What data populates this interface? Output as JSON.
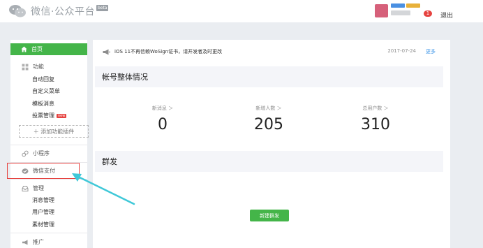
{
  "header": {
    "logo_text": "微信·公众平台",
    "beta_label": "beta",
    "notification_count": "1",
    "logout_label": "退出"
  },
  "sidebar": {
    "home_label": "首页",
    "function_group": "功能",
    "function_items": [
      "自动回复",
      "自定义菜单",
      "模板消息",
      "投票管理"
    ],
    "new_badge": "new",
    "add_plugin_label": "＋ 添加功能插件",
    "mini_program_label": "小程序",
    "wechat_pay_label": "微信支付",
    "management_group": "管理",
    "management_items": [
      "消息管理",
      "用户管理",
      "素材管理"
    ],
    "promotion_group": "推广"
  },
  "main": {
    "notice_text": "iOS 11不再信赖WoSign证书，请开发者及时更改",
    "notice_date": "2017-07-24",
    "notice_more": "更多",
    "overview_title": "帐号整体情况",
    "stats": [
      {
        "label": "新消息 ＞",
        "value": "0"
      },
      {
        "label": "新增人数 ＞",
        "value": "205"
      },
      {
        "label": "总用户数 ＞",
        "value": "310"
      }
    ],
    "broadcast_title": "群发",
    "new_broadcast_button": "新建群发"
  },
  "colors": {
    "accent_green": "#44b549",
    "highlight_red": "#e64340",
    "annotation_arrow": "#3fc8d8"
  }
}
